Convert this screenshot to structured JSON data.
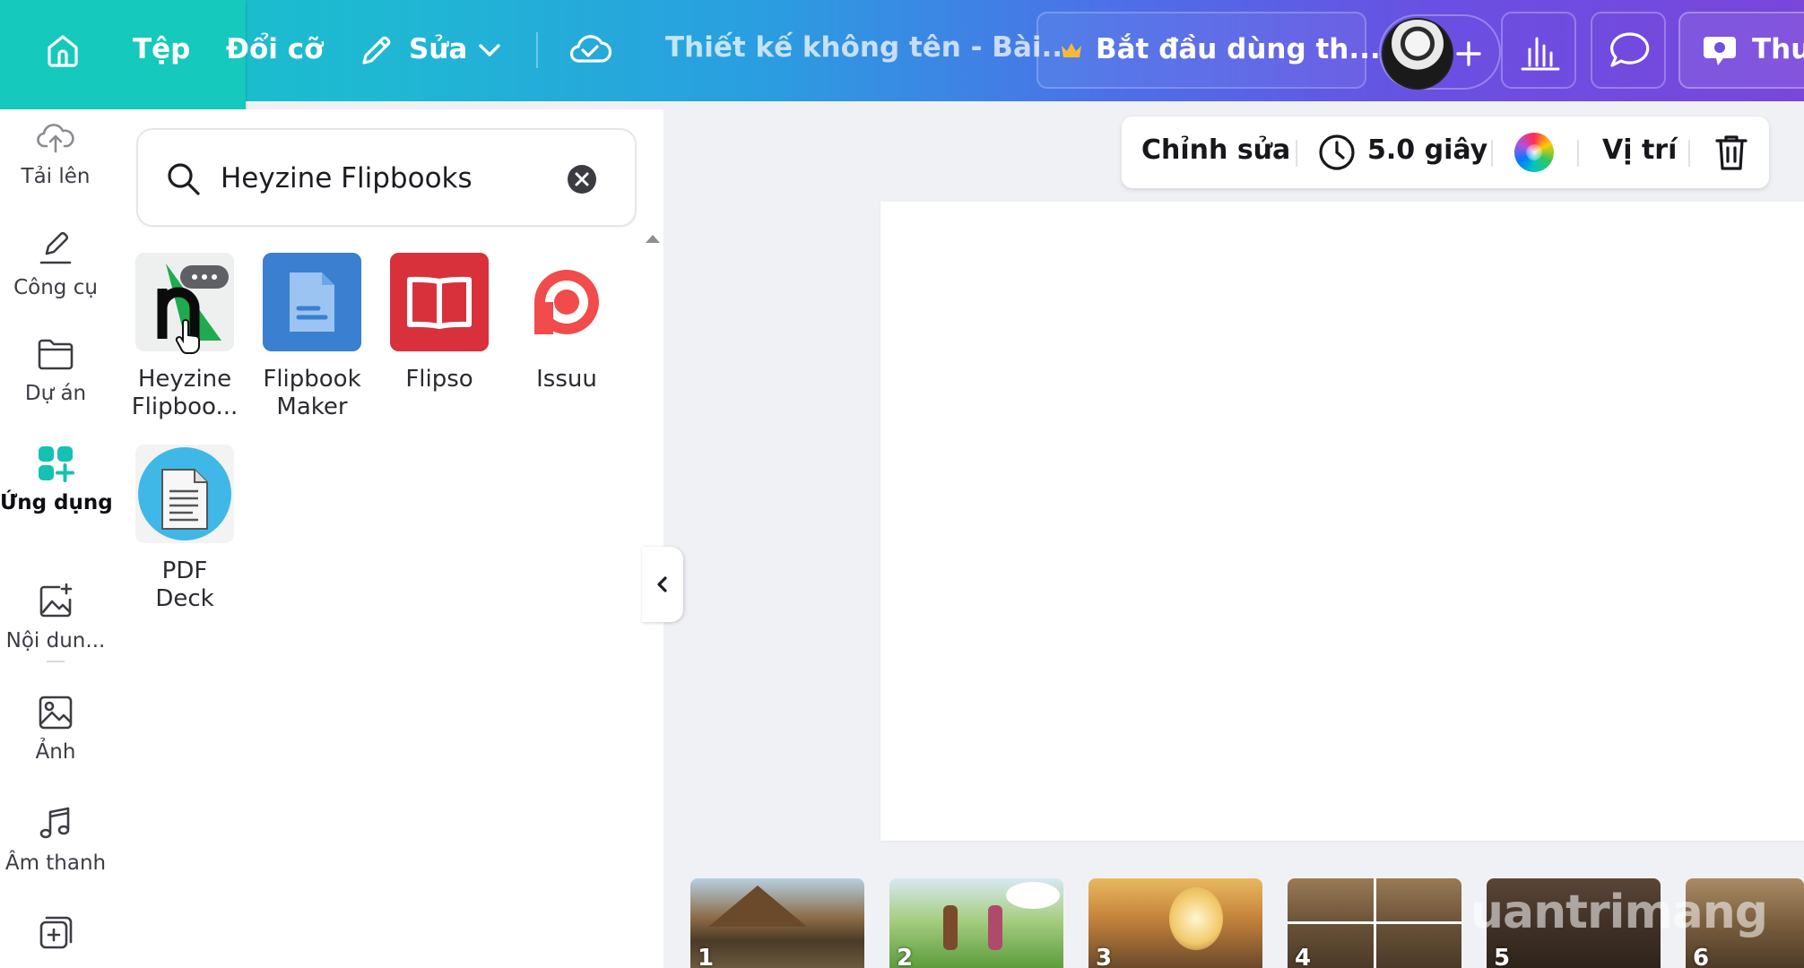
{
  "topbar": {
    "menu": {
      "file": "Tệp",
      "resize": "Đổi cỡ",
      "edit": "Sửa"
    },
    "doc_title": "Thiết kế không tên - Bài...",
    "trial_button": "Bắt đầu dùng th...",
    "present_button": "Thuy"
  },
  "rail": {
    "items": [
      {
        "label": "Tải lên",
        "icon": "cloud-upload-icon"
      },
      {
        "label": "Công cụ",
        "icon": "pen-icon"
      },
      {
        "label": "Dự án",
        "icon": "folder-icon"
      },
      {
        "label": "Ứng dụng",
        "icon": "apps-icon"
      },
      {
        "label": "Nội dun...",
        "icon": "magic-image-icon"
      },
      {
        "label": "Ảnh",
        "icon": "image-icon"
      },
      {
        "label": "Âm thanh",
        "icon": "music-icon"
      }
    ]
  },
  "search": {
    "value": "Heyzine Flipbooks"
  },
  "apps": [
    {
      "name_line1": "Heyzine",
      "name_line2": "Flipboo...",
      "icon": "heyzine-logo"
    },
    {
      "name_line1": "Flipbook",
      "name_line2": "Maker",
      "icon": "flipbook-maker-logo"
    },
    {
      "name_line1": "Flipso",
      "name_line2": "",
      "icon": "flipso-logo"
    },
    {
      "name_line1": "Issuu",
      "name_line2": "",
      "icon": "issuu-logo"
    },
    {
      "name_line1": "PDF",
      "name_line2": "Deck",
      "icon": "pdf-deck-logo"
    }
  ],
  "context_bar": {
    "edit": "Chỉnh sửa",
    "duration": "5.0 giây",
    "position": "Vị trí"
  },
  "filmstrip": {
    "pages": [
      "1",
      "2",
      "3",
      "4",
      "5",
      "6"
    ]
  },
  "watermark": "uantrimang",
  "colors": {
    "accent_teal": "#13c5c2",
    "accent_purple": "#7a46db",
    "flipbook_blue": "#3a7fd0",
    "flipso_red": "#d9313c",
    "issuu_red": "#f24b4b"
  }
}
